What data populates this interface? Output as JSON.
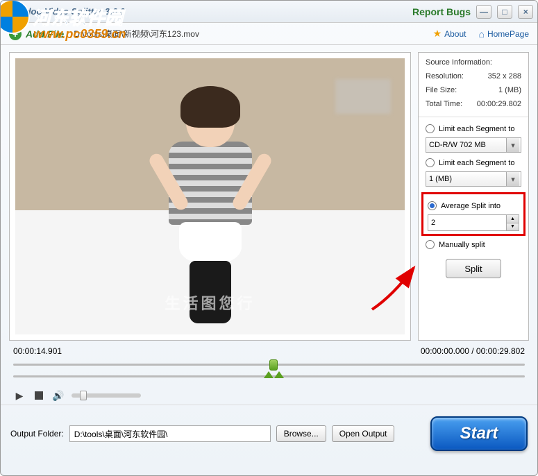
{
  "titlebar": {
    "title": "idoo Video Splitter 3.6.0",
    "report_bugs": "Report Bugs"
  },
  "watermark": {
    "text": "河东软件园",
    "sub": "www.pc0359.cn"
  },
  "toolbar": {
    "add_file": "Add File",
    "file_path": "D:\\tools\\桌面\\新视频\\河东123.mov",
    "about": "About",
    "homepage": "HomePage"
  },
  "video": {
    "watermark_text": "生活图您行"
  },
  "source_info": {
    "header": "Source Information:",
    "resolution_label": "Resolution:",
    "resolution_value": "352 x 288",
    "filesize_label": "File Size:",
    "filesize_value": "1 (MB)",
    "totaltime_label": "Total Time:",
    "totaltime_value": "00:00:29.802"
  },
  "options": {
    "limit_size_label": "Limit each Segment to",
    "limit_size_value": "CD-R/W 702 MB",
    "limit_mb_label": "Limit each Segment to",
    "limit_mb_value": "1 (MB)",
    "average_label": "Average Split into",
    "average_value": "2",
    "manual_label": "Manually split",
    "split_button": "Split"
  },
  "timeline": {
    "current": "00:00:14.901",
    "range": "00:00:00.000 / 00:00:29.802"
  },
  "output": {
    "label": "Output Folder:",
    "path": "D:\\tools\\桌面\\河东软件园\\",
    "browse": "Browse...",
    "open": "Open Output"
  },
  "start_button": "Start"
}
